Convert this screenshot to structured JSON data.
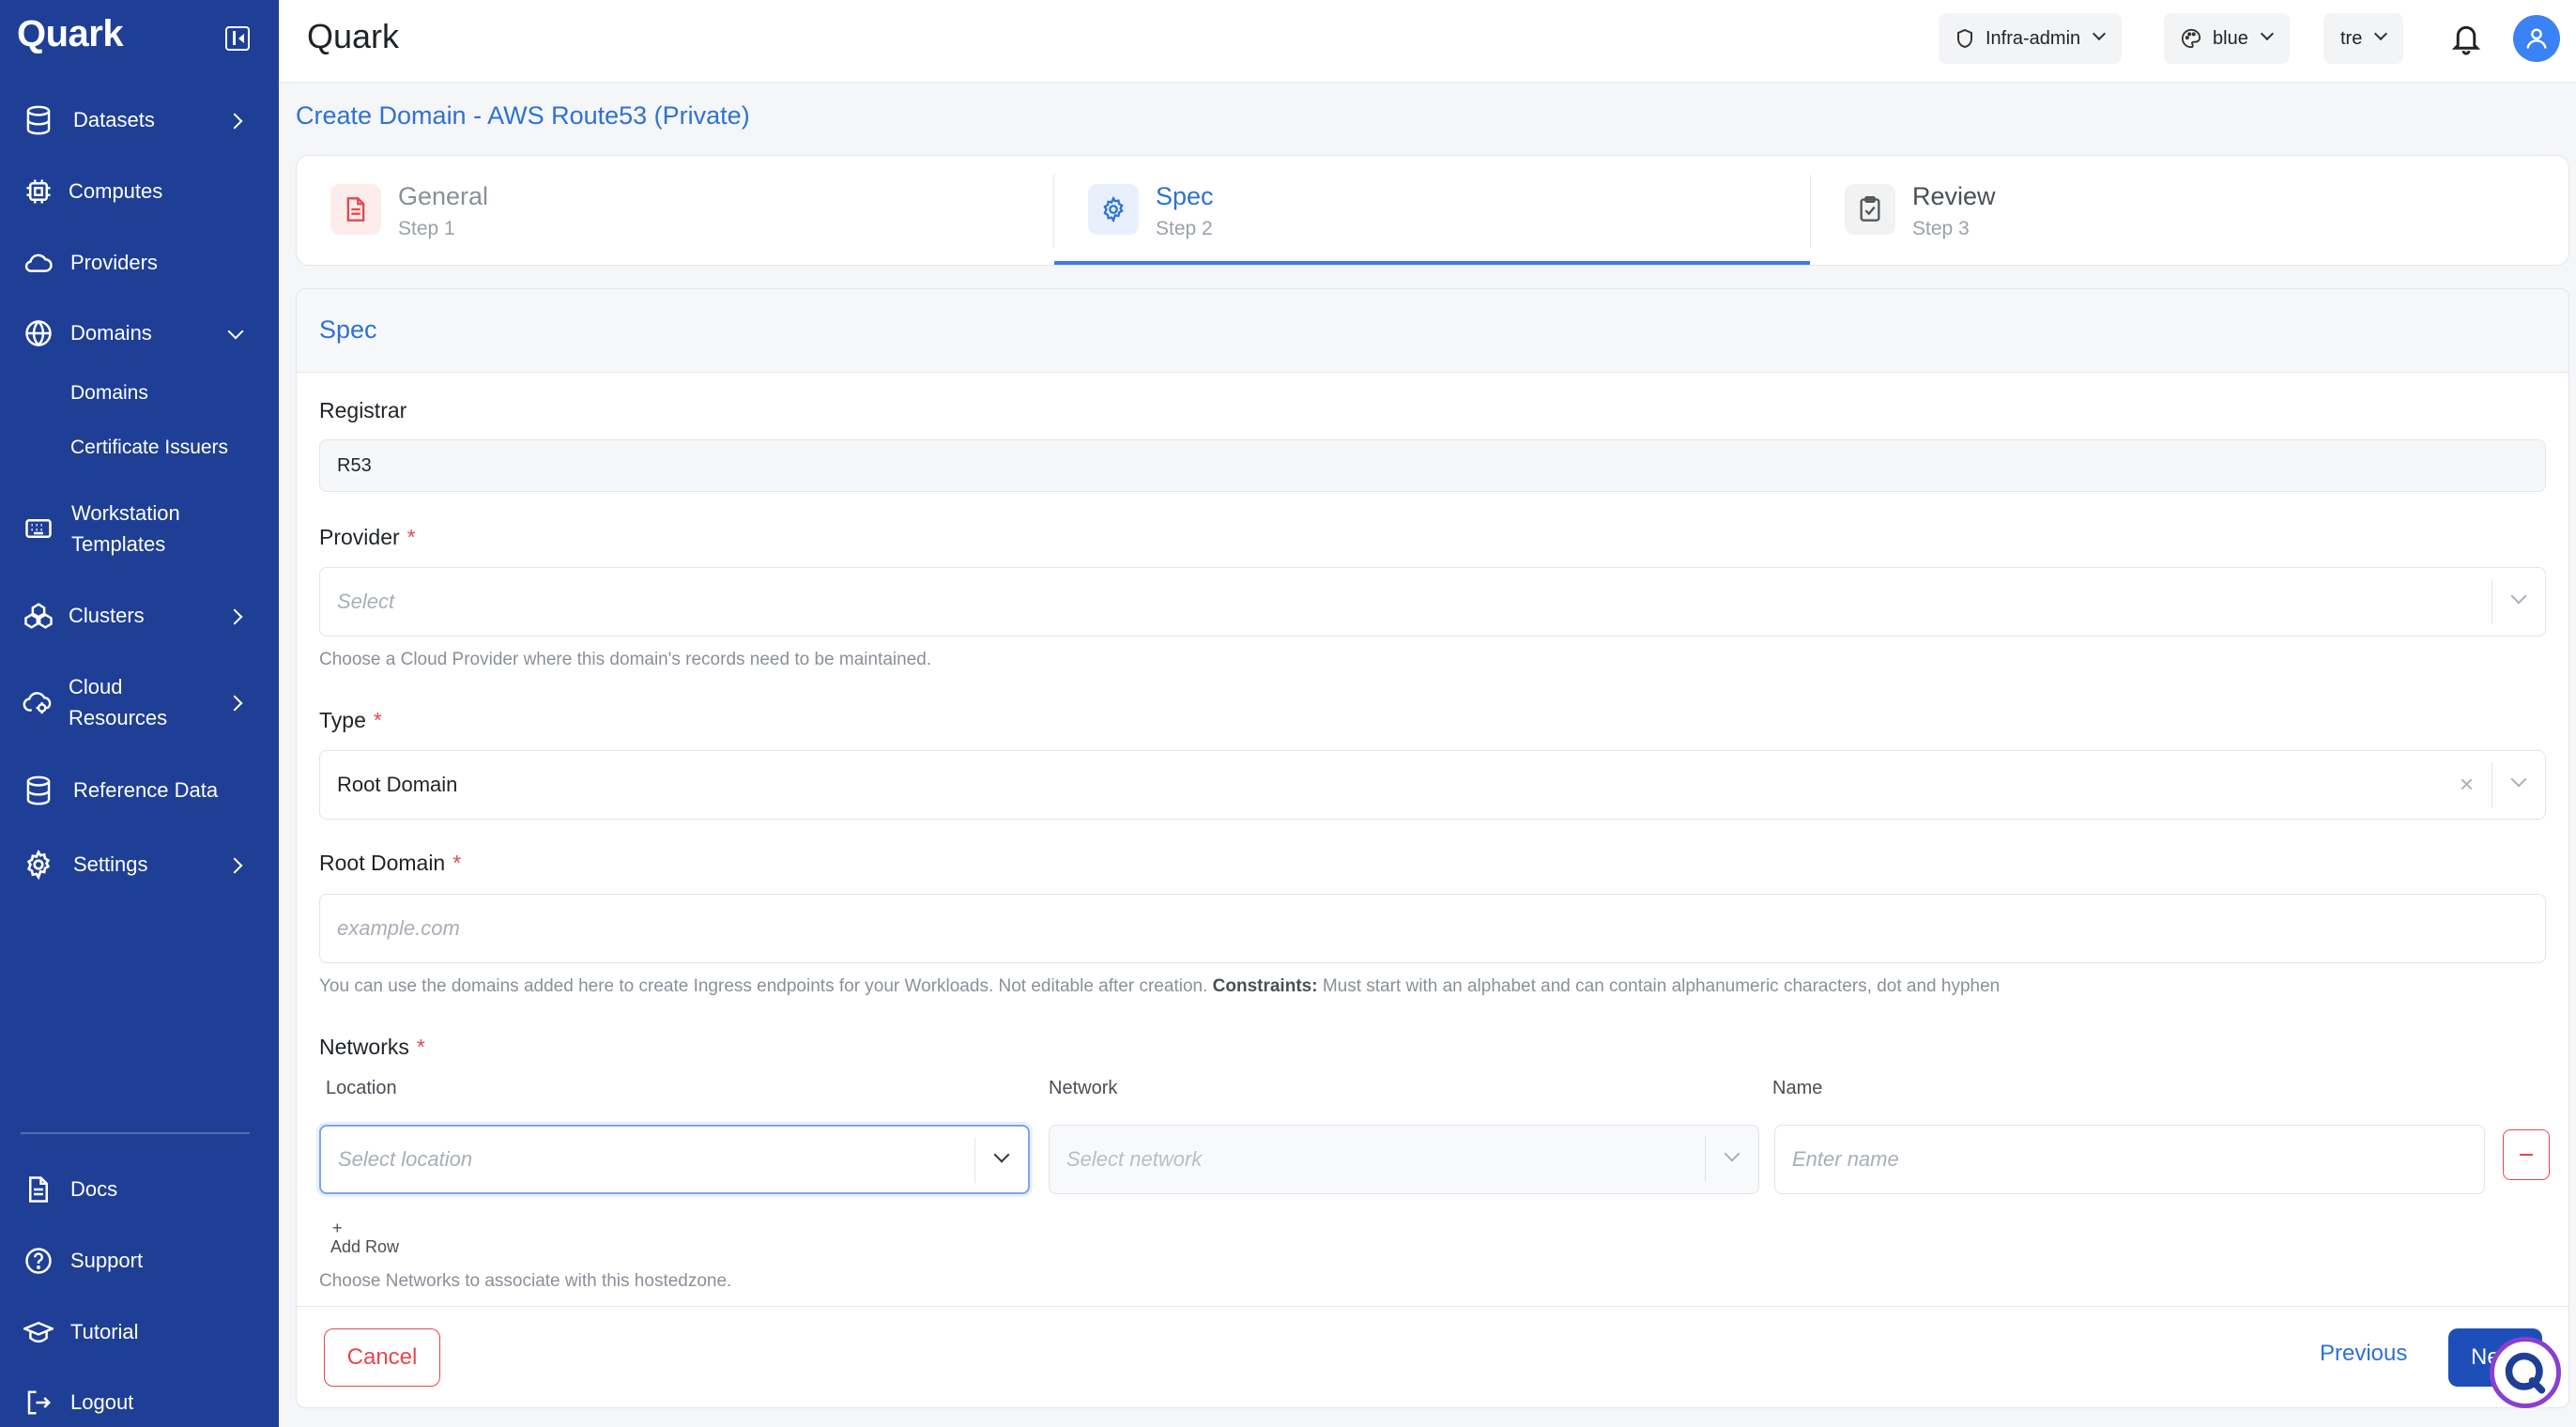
{
  "app": {
    "logo": "Quark",
    "title": "Quark"
  },
  "sidebar": {
    "items": [
      {
        "label": "Datasets",
        "icon": "database-icon"
      },
      {
        "label": "Computes",
        "icon": "cpu-icon"
      },
      {
        "label": "Providers",
        "icon": "cloud-icon"
      },
      {
        "label": "Domains",
        "icon": "globe-icon"
      },
      {
        "label": "Workstation Templates",
        "icon": "keyboard-icon"
      },
      {
        "label": "Clusters",
        "icon": "cluster-icon"
      },
      {
        "label": "Cloud Resources",
        "icon": "cloud-gear-icon"
      },
      {
        "label": "Reference Data",
        "icon": "database-icon"
      },
      {
        "label": "Settings",
        "icon": "gear-icon"
      }
    ],
    "domains_sub": [
      "Domains",
      "Certificate Issuers"
    ],
    "bottom": [
      {
        "label": "Docs",
        "icon": "document-icon"
      },
      {
        "label": "Support",
        "icon": "help-circle-icon"
      },
      {
        "label": "Tutorial",
        "icon": "graduation-cap-icon"
      },
      {
        "label": "Logout",
        "icon": "logout-icon"
      }
    ]
  },
  "topbar": {
    "role": "Infra-admin",
    "theme": "blue",
    "tenant": "tre"
  },
  "page": {
    "title": "Create Domain - AWS Route53 (Private)"
  },
  "steps": [
    {
      "title": "General",
      "sub": "Step 1"
    },
    {
      "title": "Spec",
      "sub": "Step 2"
    },
    {
      "title": "Review",
      "sub": "Step 3"
    }
  ],
  "form": {
    "section_title": "Spec",
    "registrar": {
      "label": "Registrar",
      "value": "R53"
    },
    "provider": {
      "label": "Provider",
      "placeholder": "Select",
      "help": "Choose a Cloud Provider where this domain's records need to be maintained."
    },
    "type": {
      "label": "Type",
      "value": "Root Domain",
      "clear": "×"
    },
    "root_domain": {
      "label": "Root Domain",
      "placeholder": "example.com",
      "help": "You can use the domains added here to create Ingress endpoints for your Workloads. Not editable after creation.",
      "help_bold": "Constraints:",
      "help_tail": "Must start with an alphabet and can contain alphanumeric characters, dot and hyphen"
    },
    "networks": {
      "label": "Networks",
      "columns": [
        "Location",
        "Network",
        "Name"
      ],
      "location_placeholder": "Select location",
      "network_placeholder": "Select network",
      "name_placeholder": "Enter name",
      "add_row_plus": "+",
      "add_row": "Add Row",
      "help": "Choose Networks to associate with this hostedzone."
    },
    "required_mark": "*"
  },
  "footer": {
    "cancel": "Cancel",
    "previous": "Previous",
    "next": "Ne"
  },
  "colors": {
    "sidebar": "#1e3f95",
    "accent": "#2e72d2",
    "danger": "#e5484d",
    "primary_button": "#1e4fb8"
  }
}
